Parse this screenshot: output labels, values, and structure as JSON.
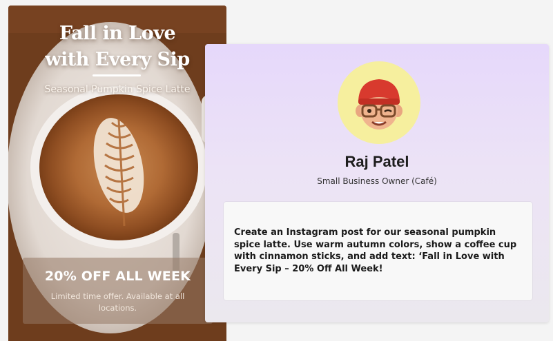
{
  "post": {
    "headline_line1": "Fall in Love",
    "headline_line2": "with Every Sip",
    "subheadline": "Seasonal Pumpkin Spice Latte",
    "promo_title": "20% OFF ALL WEEK",
    "promo_subtitle": "Limited time offer. Available at all locations.",
    "colors": {
      "background": "#6e3d1d",
      "promo_box": "#967864"
    }
  },
  "persona": {
    "avatar_icon": "memoji-avatar-icon",
    "name": "Raj Patel",
    "role": "Small Business Owner (Café)",
    "prompt": "Create an Instagram post for our seasonal pumpkin spice latte. Use warm autumn colors, show a coffee cup with cinnamon sticks, and add text: ‘Fall in Love with Every Sip – 20% Off All Week!",
    "colors": {
      "card_top": "#e6d8fb",
      "avatar_bg": "#f6ef9e",
      "prompt_bg": "#f8f8f8"
    }
  }
}
